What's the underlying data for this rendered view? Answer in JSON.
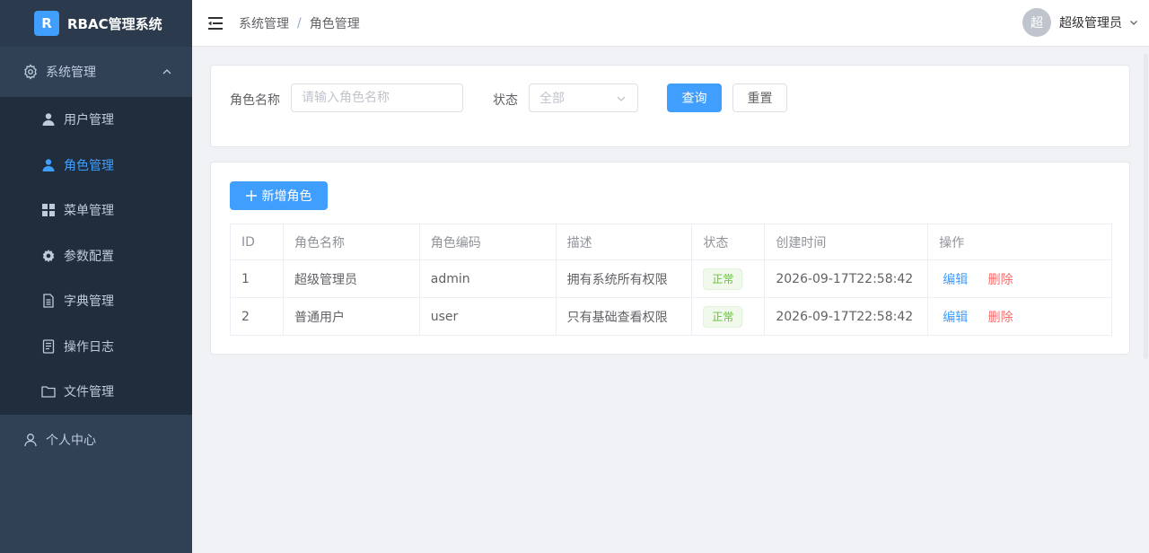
{
  "brand": {
    "logo": "R",
    "title": "RBAC管理系统"
  },
  "sidebar": {
    "parent": {
      "label": "系统管理",
      "icon": "gear-icon",
      "expanded": true
    },
    "items": [
      {
        "label": "用户管理",
        "icon": "user-icon",
        "active": false
      },
      {
        "label": "角色管理",
        "icon": "user-icon",
        "active": true
      },
      {
        "label": "菜单管理",
        "icon": "grid-icon",
        "active": false
      },
      {
        "label": "参数配置",
        "icon": "cog-icon",
        "active": false
      },
      {
        "label": "字典管理",
        "icon": "document-icon",
        "active": false
      },
      {
        "label": "操作日志",
        "icon": "log-icon",
        "active": false
      },
      {
        "label": "文件管理",
        "icon": "folder-icon",
        "active": false
      }
    ],
    "bottom": {
      "label": "个人中心",
      "icon": "person-icon"
    }
  },
  "header": {
    "breadcrumb": [
      "系统管理",
      "角色管理"
    ],
    "breadcrumb_sep": "/",
    "user": {
      "avatar_text": "超",
      "name": "超级管理员"
    }
  },
  "search": {
    "role_name_label": "角色名称",
    "role_name_placeholder": "请输入角色名称",
    "role_name_value": "",
    "status_label": "状态",
    "status_value": "全部",
    "query_label": "查询",
    "reset_label": "重置"
  },
  "table": {
    "add_label": "新增角色",
    "columns": [
      "ID",
      "角色名称",
      "角色编码",
      "描述",
      "状态",
      "创建时间",
      "操作"
    ],
    "rows": [
      {
        "id": "1",
        "name": "超级管理员",
        "code": "admin",
        "desc": "拥有系统所有权限",
        "status": "正常",
        "created": "2026-09-17T22:58:42"
      },
      {
        "id": "2",
        "name": "普通用户",
        "code": "user",
        "desc": "只有基础查看权限",
        "status": "正常",
        "created": "2026-09-17T22:58:42"
      }
    ],
    "edit_label": "编辑",
    "delete_label": "删除"
  },
  "colors": {
    "sidebar_bg": "#304156",
    "submenu_bg": "#1f2d3d",
    "accent": "#409eff",
    "success": "#67c23a",
    "danger": "#f56c6c"
  }
}
